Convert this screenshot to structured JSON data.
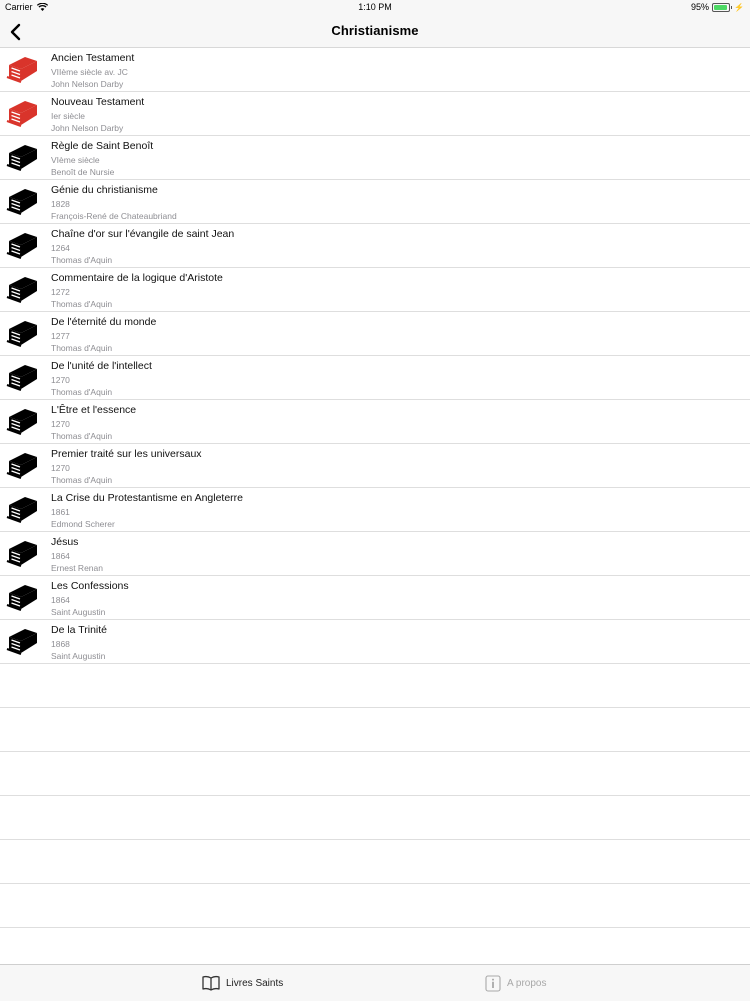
{
  "status": {
    "carrier": "Carrier",
    "time": "1:10 PM",
    "battery": "95%",
    "battery_level": 0.95
  },
  "nav": {
    "title": "Christianisme"
  },
  "books": [
    {
      "title": "Ancien Testament",
      "date": "VIIème siècle av. JC",
      "author": "John Nelson Darby",
      "icon": "book-icon-red"
    },
    {
      "title": "Nouveau Testament",
      "date": "Ier siècle",
      "author": "John Nelson Darby",
      "icon": "book-icon-red"
    },
    {
      "title": "Règle de Saint Benoît",
      "date": "VIème siècle",
      "author": "Benoît de Nursie",
      "icon": "book-icon"
    },
    {
      "title": "Génie du christianisme",
      "date": "1828",
      "author": "François-René de Chateaubriand",
      "icon": "book-icon"
    },
    {
      "title": "Chaîne d'or sur l'évangile de saint Jean",
      "date": "1264",
      "author": "Thomas d'Aquin",
      "icon": "book-icon"
    },
    {
      "title": "Commentaire de la logique d'Aristote",
      "date": "1272",
      "author": "Thomas d'Aquin",
      "icon": "book-icon"
    },
    {
      "title": "De l'éternité du monde",
      "date": "1277",
      "author": "Thomas d'Aquin",
      "icon": "book-icon"
    },
    {
      "title": "De l'unité de l'intellect",
      "date": "1270",
      "author": "Thomas d'Aquin",
      "icon": "book-icon"
    },
    {
      "title": "L'Être et l'essence",
      "date": "1270",
      "author": "Thomas d'Aquin",
      "icon": "book-icon"
    },
    {
      "title": "Premier traité sur les universaux",
      "date": "1270",
      "author": "Thomas d'Aquin",
      "icon": "book-icon"
    },
    {
      "title": "La Crise du Protestantisme en Angleterre",
      "date": "1861",
      "author": "Edmond Scherer",
      "icon": "book-icon"
    },
    {
      "title": "Jésus",
      "date": "1864",
      "author": "Ernest Renan",
      "icon": "book-icon"
    },
    {
      "title": "Les Confessions",
      "date": "1864",
      "author": "Saint Augustin",
      "icon": "book-icon"
    },
    {
      "title": "De la Trinité",
      "date": "1868",
      "author": "Saint Augustin",
      "icon": "book-icon"
    }
  ],
  "tabs": [
    {
      "label": "Livres Saints",
      "icon": "open-book-icon",
      "active": true
    },
    {
      "label": "A propos",
      "icon": "info-icon",
      "active": false
    }
  ],
  "colors": {
    "accent_red": "#d9342b",
    "book_black": "#000000",
    "inactive_tab": "#a8a8a8"
  }
}
